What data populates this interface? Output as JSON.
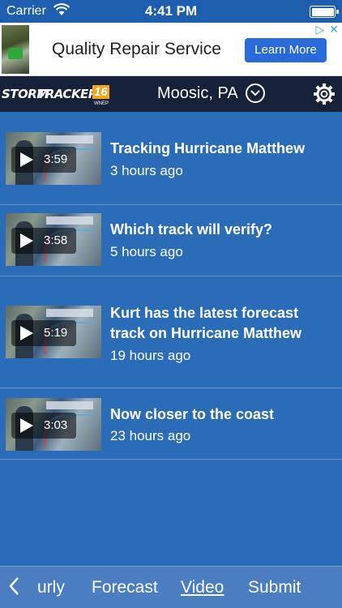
{
  "status_bar": {
    "carrier": "Carrier",
    "time": "4:41 PM",
    "battery_level": 1.0
  },
  "ad": {
    "text": "Quality Repair Service",
    "button_label": "Learn More"
  },
  "header": {
    "logo": {
      "storm": "STORM",
      "tracker": "TRACKER",
      "number": "16",
      "sub": "WNEP"
    },
    "location": "Moosic, PA"
  },
  "videos": [
    {
      "title": "Tracking Hurricane Matthew",
      "time": "3 hours ago",
      "duration": "3:59"
    },
    {
      "title": "Which track will verify?",
      "time": "5 hours ago",
      "duration": "3:58"
    },
    {
      "title": "Kurt has the latest forecast track on Hurricane Matthew",
      "time": "19 hours ago",
      "duration": "5:19"
    },
    {
      "title": "Now closer to the coast",
      "time": "23 hours ago",
      "duration": "3:03"
    }
  ],
  "bottom_nav": {
    "items": [
      "urly",
      "Forecast",
      "Video",
      "Submit"
    ],
    "active": "Video"
  },
  "colors": {
    "background": "#2a6cb8",
    "header": "#16223a",
    "ad_button": "#2a6ad8",
    "nav": "#4a7ec1"
  }
}
